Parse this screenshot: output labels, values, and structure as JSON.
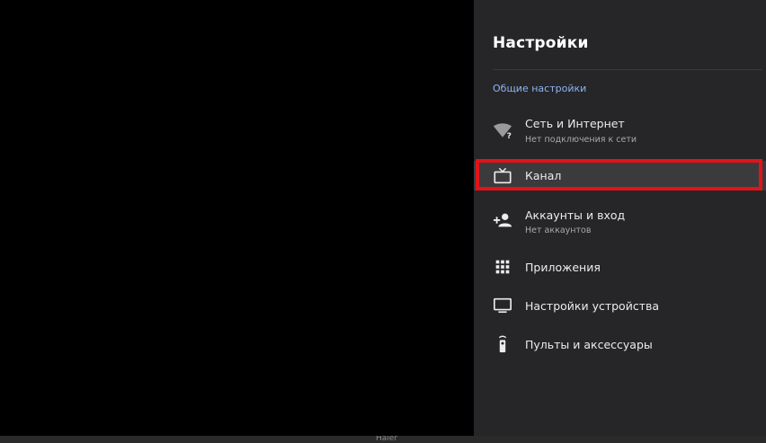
{
  "settings": {
    "title": "Настройки",
    "section_header": "Общие настройки",
    "items": [
      {
        "icon": "wifi-question-icon",
        "label": "Сеть и Интернет",
        "sublabel": "Нет подключения к сети"
      },
      {
        "icon": "tv-icon",
        "label": "Канал",
        "sublabel": ""
      },
      {
        "icon": "add-person-icon",
        "label": "Аккаунты и вход",
        "sublabel": "Нет аккаунтов"
      },
      {
        "icon": "apps-grid-icon",
        "label": "Приложения",
        "sublabel": ""
      },
      {
        "icon": "monitor-icon",
        "label": "Настройки устройства",
        "sublabel": ""
      },
      {
        "icon": "remote-icon",
        "label": "Пульты и аксессуары",
        "sublabel": ""
      }
    ],
    "selected_index": 1
  },
  "footer": {
    "brand": "Haier"
  },
  "colors": {
    "panel_bg": "#262628",
    "section_header": "#8fb3f2",
    "highlight": "#e0141a"
  }
}
